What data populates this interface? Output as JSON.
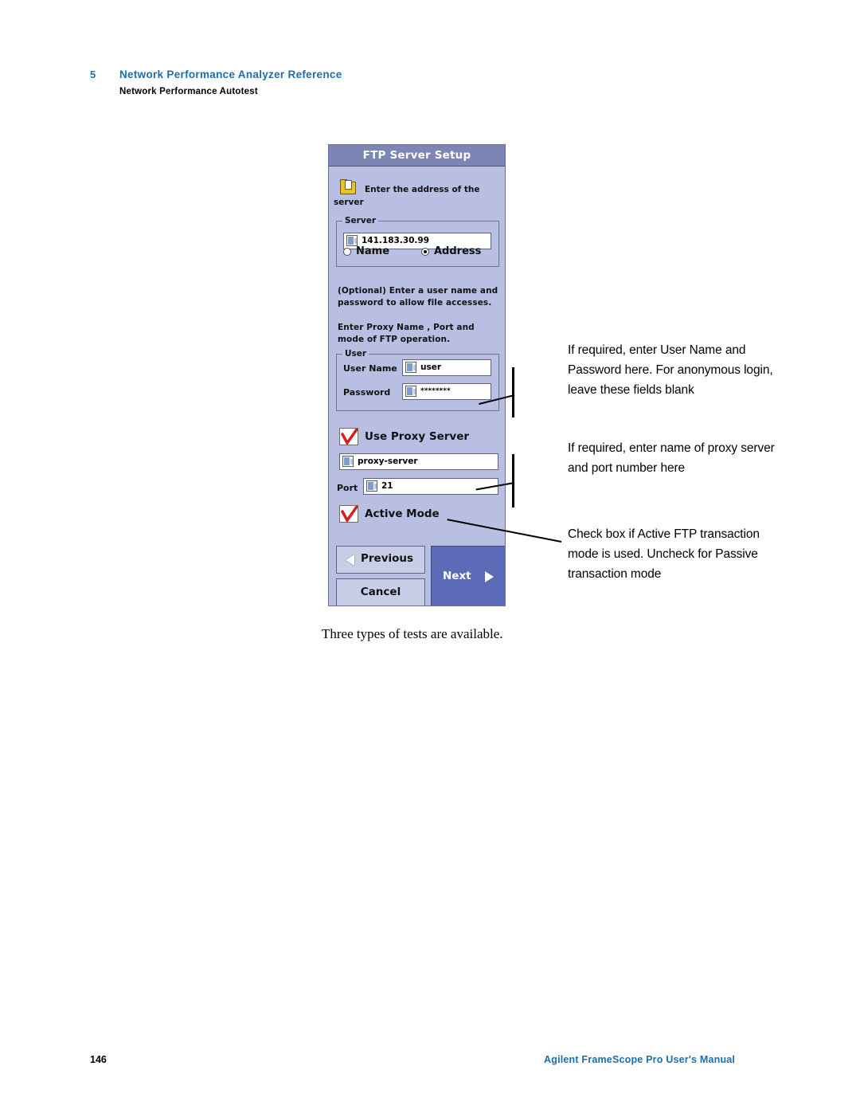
{
  "page": {
    "chapter_number": "5",
    "chapter_title": "Network Performance Analyzer Reference",
    "section_title": "Network Performance Autotest",
    "page_number": "146",
    "footer_text": "Agilent FrameScope Pro User's Manual",
    "body_text": "Three types of tests are available."
  },
  "dialog": {
    "title": "FTP Server Setup",
    "hint_line1": "Enter the address of the",
    "hint_line2": "server",
    "server_group": {
      "legend": "Server",
      "address_value": "141.183.30.99",
      "radio_name_label": "Name",
      "radio_address_label": "Address",
      "selected": "Address"
    },
    "paragraph_1": "(Optional) Enter a user name and password to allow file accesses.",
    "paragraph_2": "Enter Proxy Name , Port  and mode of FTP operation.",
    "user_group": {
      "legend": "User",
      "user_name_label": "User Name",
      "user_name_value": "user",
      "password_label": "Password",
      "password_value": "********"
    },
    "use_proxy_label": "Use Proxy Server",
    "use_proxy_checked": true,
    "proxy_server_value": "proxy-server",
    "port_label": "Port",
    "port_value": "21",
    "active_mode_label": "Active Mode",
    "active_mode_checked": true,
    "buttons": {
      "previous": "Previous",
      "cancel": "Cancel",
      "next": "Next"
    }
  },
  "callouts": [
    "If required, enter User Name and Password here. For anonymous login, leave these fields blank",
    "If required, enter name of proxy server and port number here",
    "Check box if Active FTP transaction mode is used. Uncheck for Passive transaction mode"
  ]
}
